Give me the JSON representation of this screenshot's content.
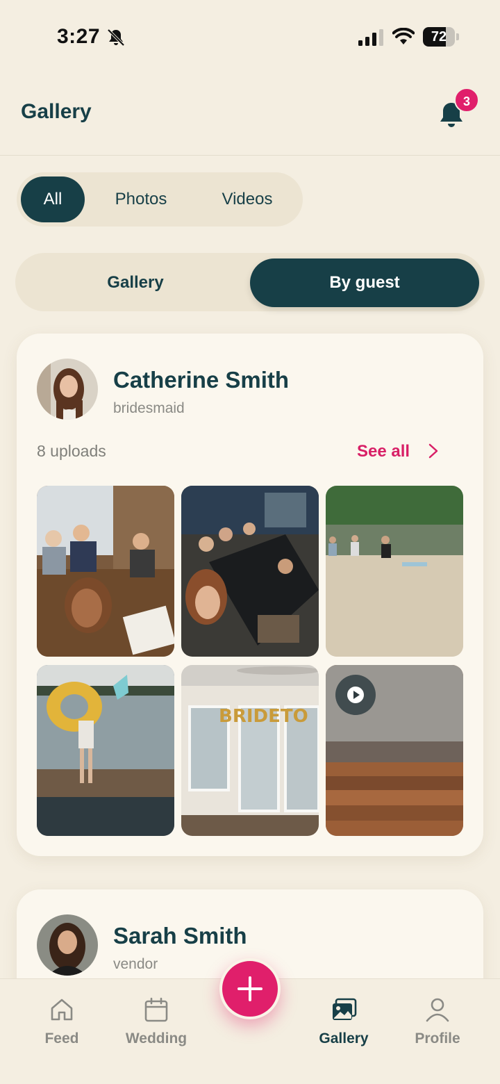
{
  "status": {
    "time": "3:27",
    "battery": "72",
    "battery_level": 0.72
  },
  "header": {
    "title": "Gallery",
    "notification_count": "3"
  },
  "media_filter": {
    "options": [
      "All",
      "Photos",
      "Videos"
    ],
    "selected": "All"
  },
  "view_toggle": {
    "options": [
      "Gallery",
      "By guest"
    ],
    "selected": "By guest"
  },
  "guests": [
    {
      "name": "Catherine Smith",
      "role": "bridesmaid",
      "uploads": "8 uploads",
      "see_all": "See all",
      "media": [
        {
          "type": "photo",
          "subject": "friends-restaurant-selfie"
        },
        {
          "type": "photo",
          "subject": "group-dinner-table"
        },
        {
          "type": "photo",
          "subject": "beach-lake"
        },
        {
          "type": "photo",
          "subject": "dock-inflatable"
        },
        {
          "type": "photo",
          "subject": "bride-to-be-balloons"
        },
        {
          "type": "video",
          "subject": "wooden-floor"
        }
      ]
    },
    {
      "name": "Sarah Smith",
      "role": "vendor"
    }
  ],
  "tabbar": {
    "items": [
      {
        "label": "Feed",
        "icon": "home-icon"
      },
      {
        "label": "Wedding",
        "icon": "calendar-icon"
      },
      {
        "label": "Gallery",
        "icon": "gallery-icon",
        "active": true
      },
      {
        "label": "Profile",
        "icon": "person-icon"
      }
    ],
    "fab_icon": "plus-icon"
  },
  "colors": {
    "primary": "#173f47",
    "accent": "#e01f6b",
    "background": "#f4eee1",
    "card": "#fbf7ee"
  }
}
